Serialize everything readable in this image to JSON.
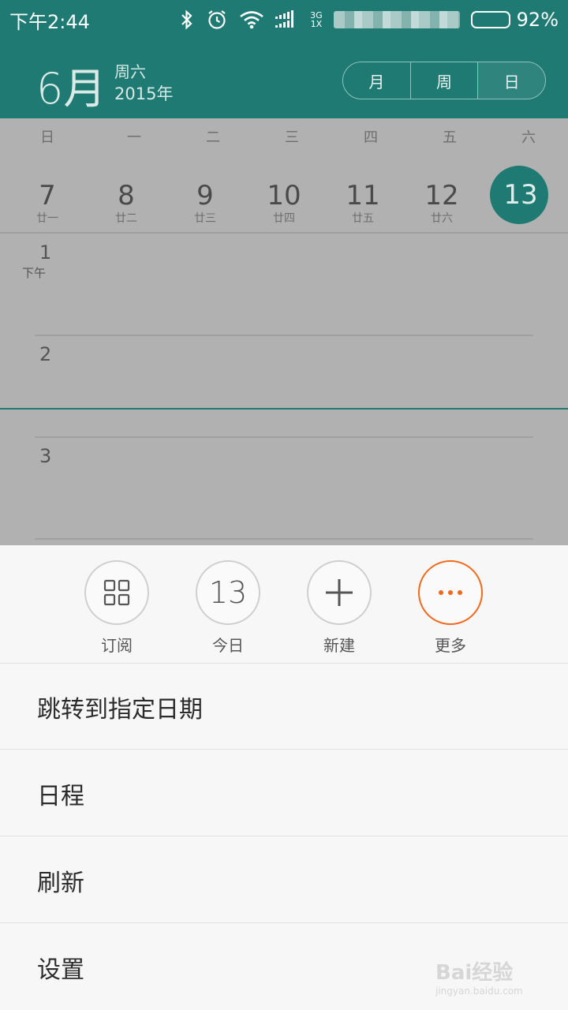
{
  "statusbar": {
    "time": "下午2:44",
    "network_top": "3G",
    "network_bottom": "1X",
    "battery": "92%",
    "battery_level": 0.92
  },
  "header": {
    "month": "6月",
    "weekday": "周六",
    "year": "2015年",
    "views": [
      "月",
      "周",
      "日"
    ],
    "selected_view": "日"
  },
  "calendar": {
    "weekdays": [
      "日",
      "一",
      "二",
      "三",
      "四",
      "五",
      "六"
    ],
    "dates": [
      {
        "day": "7",
        "lunar": "廿一"
      },
      {
        "day": "8",
        "lunar": "廿二"
      },
      {
        "day": "9",
        "lunar": "廿三"
      },
      {
        "day": "10",
        "lunar": "廿四"
      },
      {
        "day": "11",
        "lunar": "廿五"
      },
      {
        "day": "12",
        "lunar": "廿六"
      },
      {
        "day": "13",
        "lunar": ""
      }
    ],
    "selected_day": "13",
    "hours": [
      "1",
      "2",
      "3"
    ],
    "pm_label": "下午"
  },
  "actions": {
    "subscribe": "订阅",
    "today_num": "13",
    "today": "今日",
    "new": "新建",
    "more": "更多"
  },
  "menu": [
    "跳转到指定日期",
    "日程",
    "刷新",
    "设置"
  ],
  "watermark": {
    "main": "Bai经验",
    "sub": "jingyan.baidu.com"
  },
  "colors": {
    "accent": "#1e7a72",
    "more_orange": "#f06a1e",
    "battery_green": "#5bd62c"
  }
}
